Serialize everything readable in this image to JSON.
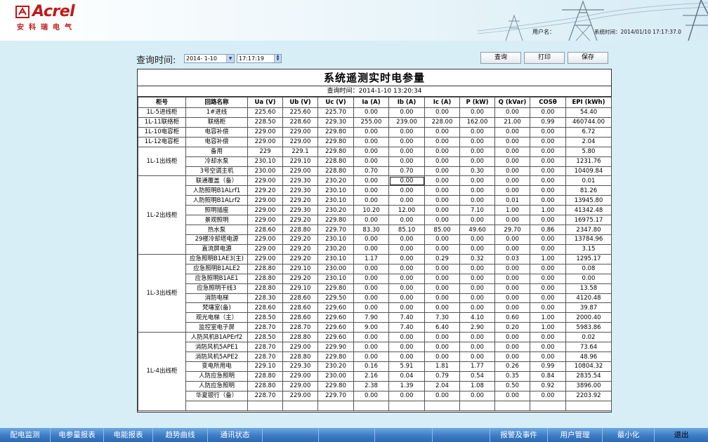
{
  "header": {
    "logo_text": "Acrel",
    "logo_sub": "安科瑞电气",
    "user_label": "用户名：",
    "system_time": "系统时间：2014/01/10 17:17:37.0"
  },
  "query": {
    "label": "查询时间:",
    "date": "2014- 1-10",
    "time": "17:17:19",
    "buttons": {
      "query": "查询",
      "print": "打印",
      "save": "保存"
    }
  },
  "report": {
    "title": "系统遥测实时电参量",
    "subtitle": "查询时间：2014-1-10 13:20:34",
    "columns": [
      "柜号",
      "回路名称",
      "Ua (V)",
      "Ub (V)",
      "Uc (V)",
      "Ia (A)",
      "Ib (A)",
      "Ic (A)",
      "P (kW)",
      "Q (kVar)",
      "COSθ",
      "EPI (kWh)"
    ],
    "rows": [
      {
        "cab": "1L-5进线柜",
        "span": 1,
        "cells": [
          "1#进线",
          "225.60",
          "225.60",
          "225.70",
          "0.00",
          "0.00",
          "0.00",
          "0.00",
          "0.00",
          "0.00",
          "54.40"
        ]
      },
      {
        "cab": "1L-11联络柜",
        "span": 1,
        "cells": [
          "联络柜",
          "228.50",
          "228.60",
          "229.30",
          "255.00",
          "239.00",
          "228.00",
          "162.00",
          "21.00",
          "0.99",
          "460744.00"
        ]
      },
      {
        "cab": "1L-10电容柜",
        "span": 1,
        "cells": [
          "电容补偿",
          "229.00",
          "229.00",
          "229.80",
          "0.00",
          "0.00",
          "0.00",
          "0.00",
          "0.00",
          "0.00",
          "6.72"
        ]
      },
      {
        "cab": "1L-12电容柜",
        "span": 1,
        "cells": [
          "电容补偿",
          "229.00",
          "229.00",
          "229.80",
          "0.00",
          "0.00",
          "0.00",
          "0.00",
          "0.00",
          "0.00",
          "2.04"
        ]
      },
      {
        "cab": "1L-1出线柜",
        "span": 3,
        "cells": [
          "备用",
          "229",
          "229.1",
          "229.80",
          "0.00",
          "0.00",
          "0.00",
          "0.00",
          "0.00",
          "0.00",
          "5.80"
        ]
      },
      {
        "cells": [
          "冷却水泵",
          "230.10",
          "229.10",
          "228.80",
          "0.00",
          "0.00",
          "0.00",
          "0.00",
          "0.00",
          "0.00",
          "1231.76"
        ]
      },
      {
        "cells": [
          "3号空调主机",
          "230.00",
          "229.00",
          "228.80",
          "0.70",
          "0.70",
          "0.00",
          "0.30",
          "0.00",
          "0.00",
          "10409.84"
        ]
      },
      {
        "cab": "1L-2出线柜",
        "span": 8,
        "cells": [
          "联通覆盖（备）",
          "229.00",
          "229.30",
          "230.20",
          "0.00",
          "0.00",
          "0.00",
          "0.00",
          "0.00",
          "0.00",
          "0.01"
        ]
      },
      {
        "cells": [
          "人防照明B1ALrf1",
          "229.20",
          "229.30",
          "230.10",
          "0.00",
          "0.00",
          "0.00",
          "0.00",
          "0.00",
          "0.00",
          "81.26"
        ]
      },
      {
        "cells": [
          "人防照明B1ALrf2",
          "229.00",
          "229.20",
          "230.10",
          "0.00",
          "0.00",
          "0.00",
          "0.00",
          "0.01",
          "0.00",
          "13945.80"
        ]
      },
      {
        "cells": [
          "照明插座",
          "229.00",
          "229.30",
          "230.20",
          "10.20",
          "12.00",
          "0.00",
          "7.10",
          "1.00",
          "1.00",
          "41342.48"
        ]
      },
      {
        "cells": [
          "景观照明",
          "229.00",
          "229.20",
          "229.80",
          "0.00",
          "0.00",
          "0.00",
          "0.00",
          "0.00",
          "0.00",
          "16975.17"
        ]
      },
      {
        "cells": [
          "热水泵",
          "228.60",
          "228.80",
          "229.70",
          "83.30",
          "85.10",
          "85.00",
          "49.60",
          "29.70",
          "0.86",
          "2347.80"
        ]
      },
      {
        "cells": [
          "29楼冷却塔电源",
          "229.00",
          "229.20",
          "230.10",
          "0.00",
          "0.00",
          "0.00",
          "0.00",
          "0.00",
          "0.00",
          "13784.96"
        ]
      },
      {
        "cells": [
          "直流屏电源",
          "229.00",
          "229.20",
          "230.20",
          "0.00",
          "0.00",
          "0.00",
          "0.00",
          "0.00",
          "0.00",
          "3.15"
        ]
      },
      {
        "cab": "1L-3出线柜",
        "span": 8,
        "cells": [
          "应急照明B1AE3(主)",
          "229.00",
          "229.20",
          "230.10",
          "1.17",
          "0.00",
          "0.29",
          "0.32",
          "0.03",
          "1.00",
          "1295.17"
        ]
      },
      {
        "cells": [
          "应急照明B1ALE2",
          "228.80",
          "229.10",
          "230.00",
          "0.00",
          "0.00",
          "0.00",
          "0.00",
          "0.00",
          "0.00",
          "0.08"
        ]
      },
      {
        "cells": [
          "应急照明B1AE1",
          "228.80",
          "229.20",
          "230.10",
          "0.00",
          "0.00",
          "0.00",
          "0.00",
          "0.00",
          "0.00",
          "0.00"
        ]
      },
      {
        "cells": [
          "应急照明干线3",
          "228.80",
          "229.10",
          "229.80",
          "0.00",
          "0.00",
          "0.00",
          "0.00",
          "0.00",
          "0.00",
          "13.58"
        ]
      },
      {
        "cells": [
          "消防电梯",
          "228.30",
          "228.60",
          "229.50",
          "0.00",
          "0.00",
          "0.00",
          "0.00",
          "0.00",
          "0.00",
          "4120.48"
        ]
      },
      {
        "cells": [
          "梵噻室(备)",
          "228.60",
          "228.60",
          "229.60",
          "0.00",
          "0.00",
          "0.00",
          "0.00",
          "0.00",
          "0.00",
          "39.87"
        ]
      },
      {
        "cells": [
          "观光电梯（主）",
          "228.50",
          "228.60",
          "229.60",
          "7.90",
          "7.40",
          "7.30",
          "4.10",
          "0.60",
          "1.00",
          "2000.40"
        ]
      },
      {
        "cells": [
          "监控室电子屏",
          "228.70",
          "228.70",
          "229.60",
          "9.00",
          "7.40",
          "6.40",
          "2.90",
          "0.20",
          "1.00",
          "5983.86"
        ]
      },
      {
        "cab": "1L-4出线柜",
        "span": 8,
        "cells": [
          "人防风机B1APErf2",
          "228.50",
          "228.80",
          "229.60",
          "0.00",
          "0.00",
          "0.00",
          "0.00",
          "0.00",
          "0.00",
          "0.02"
        ]
      },
      {
        "cells": [
          "消防风机5APE1",
          "228.70",
          "229.00",
          "229.90",
          "0.00",
          "0.00",
          "0.00",
          "0.00",
          "0.00",
          "0.00",
          "73.64"
        ]
      },
      {
        "cells": [
          "消防风机5APE2",
          "228.70",
          "228.80",
          "229.80",
          "0.00",
          "0.00",
          "0.00",
          "0.00",
          "0.00",
          "0.00",
          "48.96"
        ]
      },
      {
        "cells": [
          "变电所用电",
          "229.10",
          "229.30",
          "230.20",
          "0.16",
          "5.91",
          "1.81",
          "1.77",
          "0.26",
          "0.99",
          "10804.32"
        ]
      },
      {
        "cells": [
          "人防应急照明",
          "228.80",
          "229.00",
          "230.00",
          "2.16",
          "0.04",
          "0.79",
          "0.54",
          "0.35",
          "0.84",
          "2835.54"
        ]
      },
      {
        "cells": [
          "人防应急照明",
          "228.80",
          "229.00",
          "229.80",
          "2.38",
          "1.39",
          "2.04",
          "1.08",
          "0.50",
          "0.92",
          "3896.00"
        ]
      },
      {
        "cells": [
          "华夏银行（备）",
          "228.70",
          "229.00",
          "229.70",
          "0.00",
          "0.00",
          "0.00",
          "0.00",
          "0.00",
          "0.00",
          "2203.92"
        ]
      }
    ]
  },
  "menu": {
    "items": [
      "配电监测",
      "电参量报表",
      "电能报表",
      "趋势曲线",
      "通讯状态",
      "报警及事件",
      "用户管理",
      "最小化",
      "退出"
    ]
  }
}
